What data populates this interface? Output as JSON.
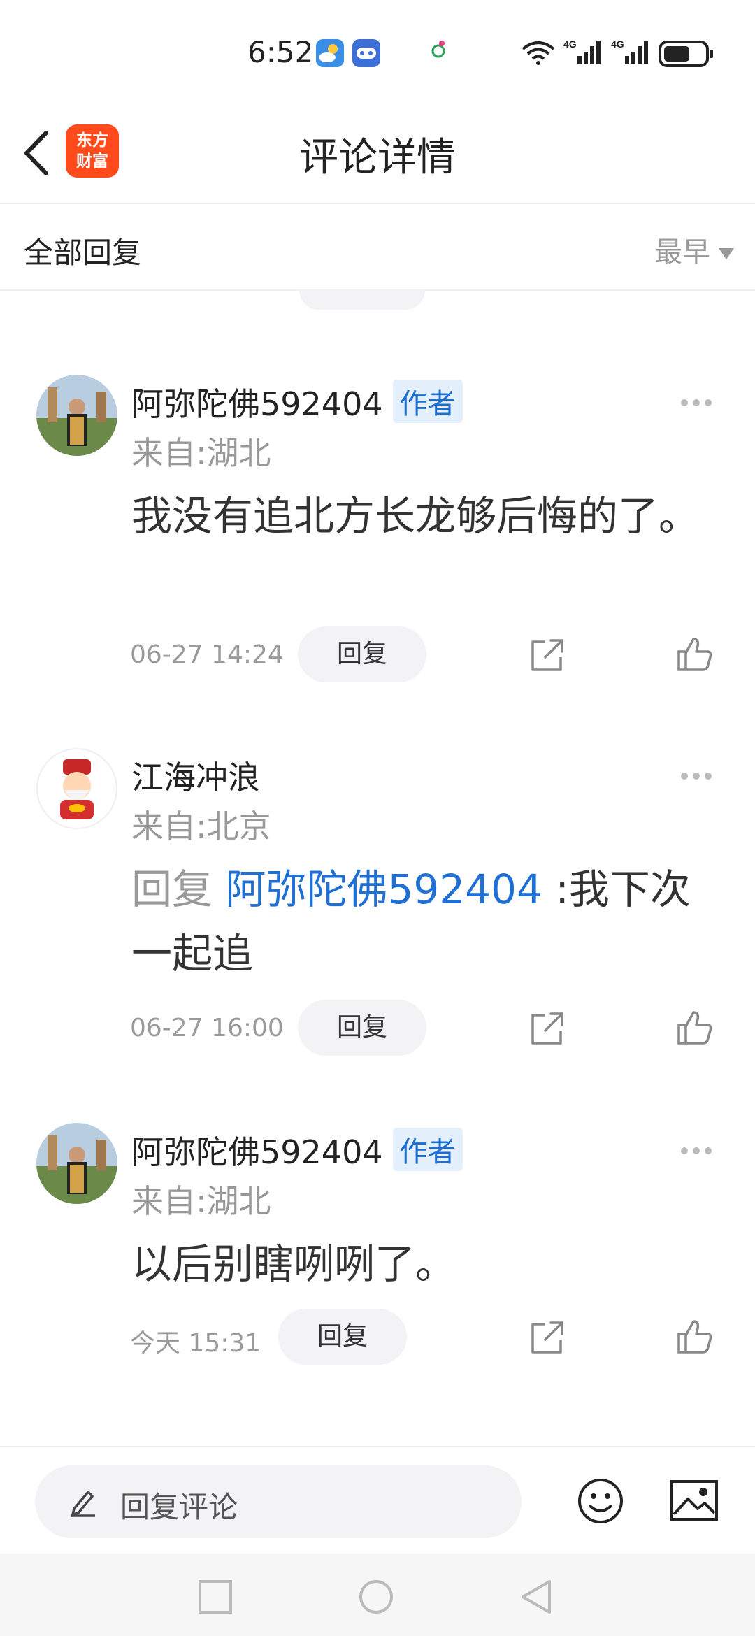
{
  "status_bar": {
    "time": "6:52",
    "icons": [
      "weather-sun-cloud-icon",
      "game-controller-icon",
      "app-notify-icon",
      "wifi-6-icon",
      "signal-4g-icon",
      "signal-4g-icon",
      "battery-icon"
    ]
  },
  "header": {
    "back_icon": "chevron-left-icon",
    "logo_text": "东方\n财富",
    "title": "评论详情"
  },
  "section": {
    "title": "全部回复",
    "sort_label": "最早"
  },
  "comments": [
    {
      "name": "阿弥陀佛592404",
      "tag": "作者",
      "location": "来自:湖北",
      "text": "我没有追北方长龙够后悔的了。",
      "time": "06-27 14:24",
      "reply_label": "回复"
    },
    {
      "name": "江海冲浪",
      "tag": "",
      "location": "来自:北京",
      "reply_prefix": "回复",
      "mention": "阿弥陀佛592404",
      "separator": ":",
      "text": "我下次一起追",
      "time": "06-27 16:00",
      "reply_label": "回复"
    },
    {
      "name": "阿弥陀佛592404",
      "tag": "作者",
      "location": "来自:湖北",
      "text": "以后别瞎咧咧了。",
      "time": "今天 15:31",
      "reply_label": "回复"
    }
  ],
  "bottom_bar": {
    "input_placeholder": "回复评论",
    "emoji_icon": "smiley-icon",
    "image_icon": "image-icon"
  },
  "colors": {
    "accent_blue": "#1f6fd4",
    "logo_orange": "#ff4a1c"
  }
}
